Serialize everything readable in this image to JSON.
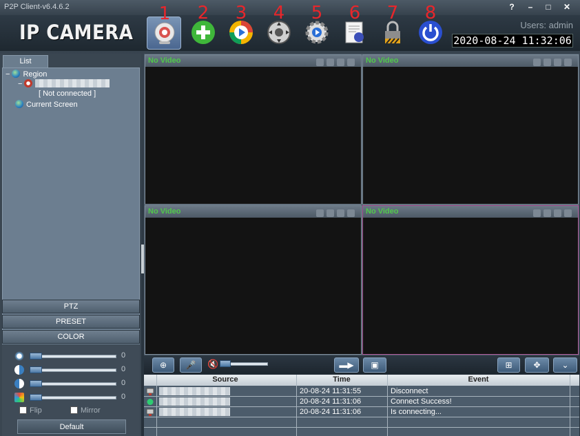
{
  "window": {
    "title": "P2P Client-v6.4.6.2",
    "buttons": [
      "?",
      "–",
      "□",
      "✕"
    ]
  },
  "header": {
    "brand": "IP CAMERA",
    "tools": [
      {
        "num": "1",
        "icon": "webcam-icon"
      },
      {
        "num": "2",
        "icon": "add-icon"
      },
      {
        "num": "3",
        "icon": "playback-icon"
      },
      {
        "num": "4",
        "icon": "ptz-control-icon"
      },
      {
        "num": "5",
        "icon": "settings-gear-icon"
      },
      {
        "num": "6",
        "icon": "log-document-icon"
      },
      {
        "num": "7",
        "icon": "lock-icon"
      },
      {
        "num": "8",
        "icon": "power-icon"
      }
    ],
    "users": "Users: admin",
    "datetime": "2020-08-24  11:32:06"
  },
  "sidebar": {
    "tab": "List",
    "tree": {
      "region": "Region",
      "device_status": "[   Not connected   ]",
      "current_screen": "Current Screen"
    },
    "panels": [
      "PTZ",
      "PRESET",
      "COLOR"
    ],
    "color": {
      "sliders": [
        {
          "icon": "brightness-icon",
          "value": "0"
        },
        {
          "icon": "contrast-icon",
          "value": "0"
        },
        {
          "icon": "saturation-icon",
          "value": "0"
        },
        {
          "icon": "hue-icon",
          "value": "0"
        }
      ],
      "flip": "Flip",
      "mirror": "Mirror",
      "default": "Default"
    }
  },
  "video": {
    "cells": [
      {
        "label": "No Video"
      },
      {
        "label": "No Video"
      },
      {
        "label": "No Video"
      },
      {
        "label": "No Video"
      }
    ]
  },
  "log": {
    "headers": {
      "source": "Source",
      "time": "Time",
      "event": "Event"
    },
    "rows": [
      {
        "time": "20-08-24 11:31:55",
        "event": "Disconnect"
      },
      {
        "time": "20-08-24 11:31:06",
        "event": "Connect Success!"
      },
      {
        "time": "20-08-24 11:31:06",
        "event": "Is connecting..."
      }
    ]
  }
}
